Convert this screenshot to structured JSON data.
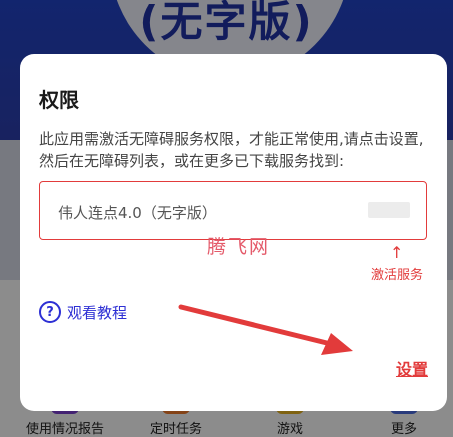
{
  "background": {
    "title": "(无字版)",
    "nav": [
      "使用情况报告",
      "定时任务",
      "游戏",
      "更多"
    ]
  },
  "dialog": {
    "title": "权限",
    "message": "此应用需激活无障碍服务权限，才能正常使用,请点击设置,然后在无障碍列表，或在更多已下载服务找到:",
    "service_name": "伟人连点4.0（无字版）",
    "watermark": "腾飞网",
    "arrow_up": "↑",
    "activate_note": "激活服务",
    "tutorial_label": "观看教程",
    "help_glyph": "?",
    "settings_label": "设置"
  },
  "colors": {
    "accent_red": "#e23b3b",
    "link_blue": "#2d2fd4"
  }
}
